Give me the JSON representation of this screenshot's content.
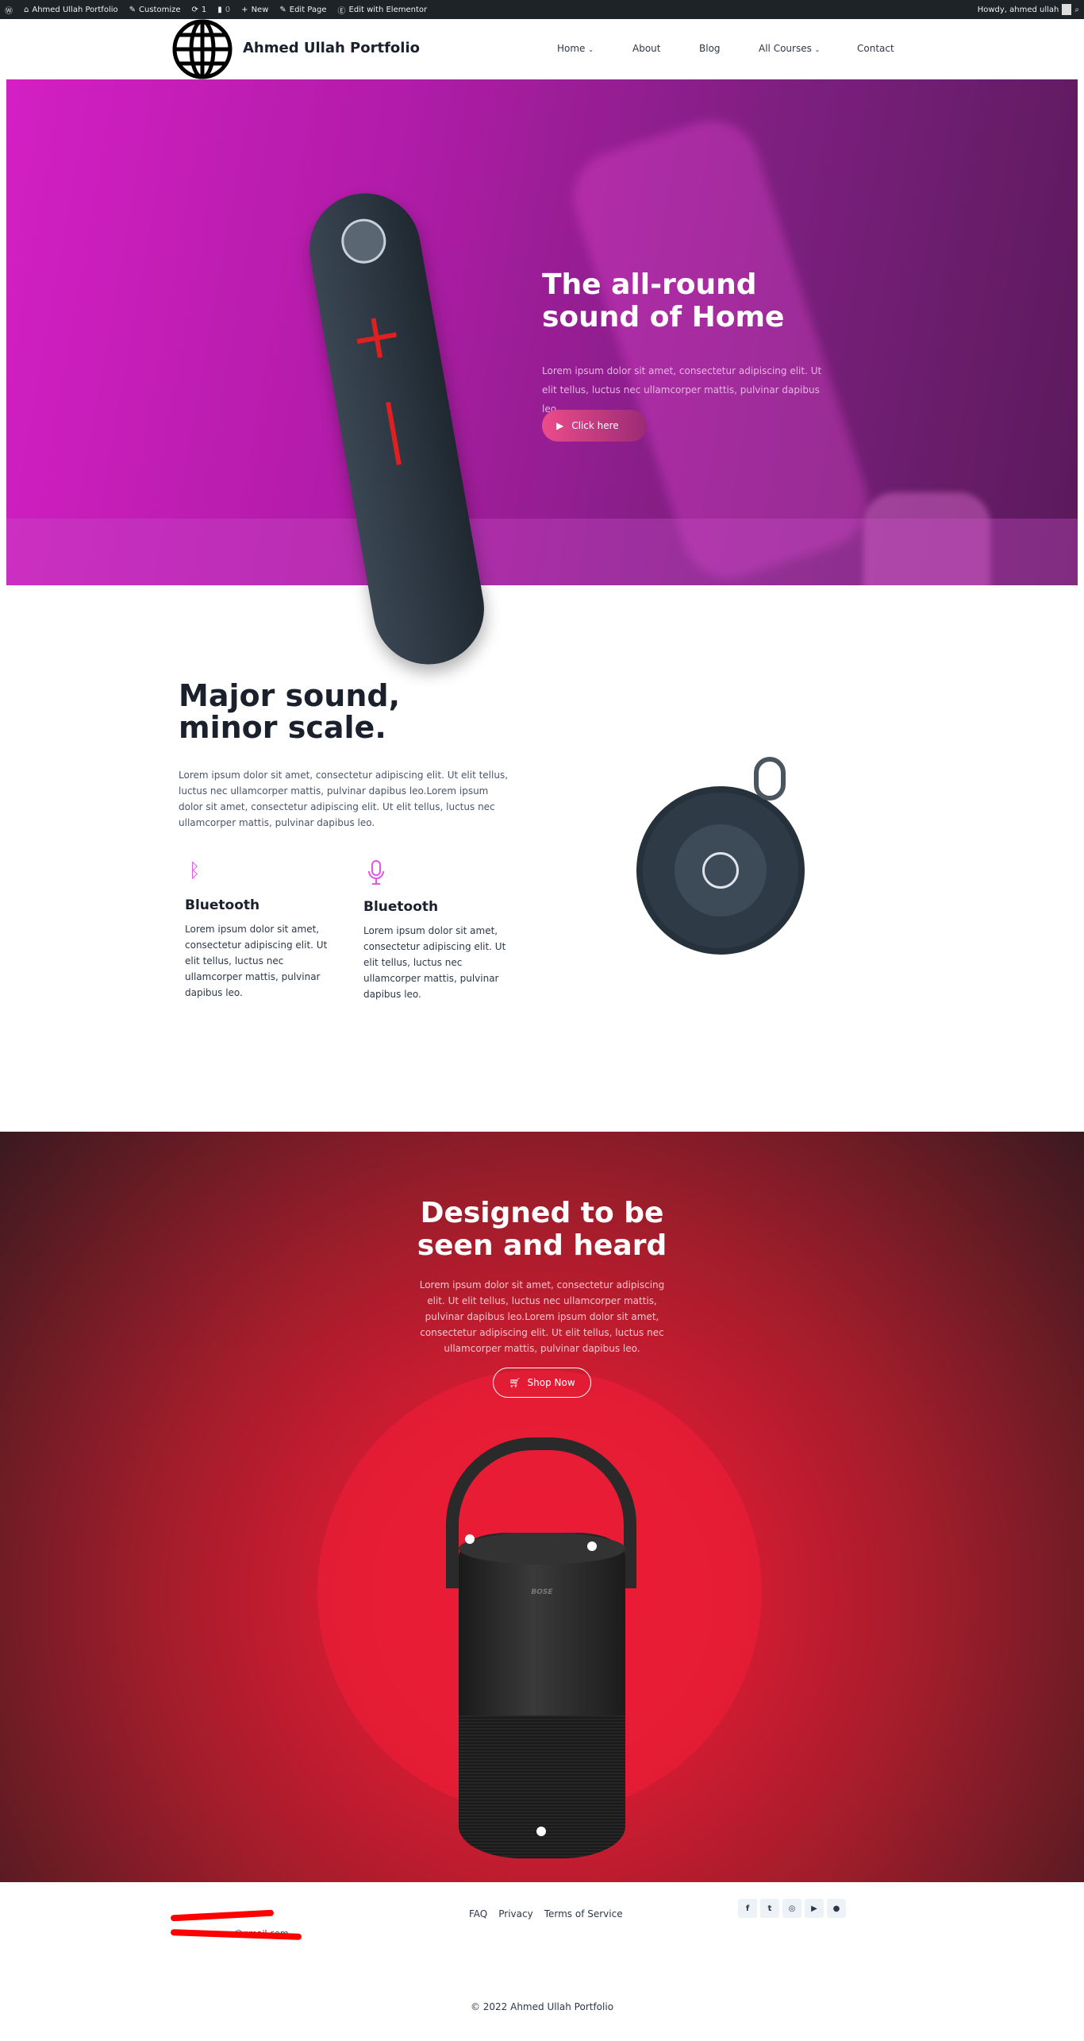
{
  "adminbar": {
    "site": "Ahmed Ullah Portfolio",
    "customize": "Customize",
    "updates": "1",
    "comments": "0",
    "new": "New",
    "edit_page": "Edit Page",
    "edit_elementor": "Edit with Elementor",
    "howdy": "Howdy, ahmed ullah"
  },
  "header": {
    "site_title": "Ahmed Ullah Portfolio",
    "nav": [
      "Home",
      "About",
      "Blog",
      "All Courses",
      "Contact"
    ]
  },
  "hero": {
    "title_line1": "The all-round",
    "title_line2": "sound of Home",
    "text": "Lorem ipsum dolor sit amet, consectetur adipiscing elit. Ut elit tellus, luctus nec ullamcorper mattis, pulvinar dapibus leo.",
    "button": "Click here"
  },
  "about": {
    "title_line1": "Major sound,",
    "title_line2": "minor scale.",
    "text": "Lorem ipsum dolor sit amet, consectetur adipiscing elit. Ut elit tellus, luctus nec ullamcorper mattis, pulvinar dapibus leo.Lorem ipsum dolor sit amet, consectetur adipiscing elit. Ut elit tellus, luctus nec ullamcorper mattis, pulvinar dapibus leo.",
    "features": [
      {
        "icon": "bluetooth-icon",
        "title": "Bluetooth",
        "text": "Lorem ipsum dolor sit amet, consectetur adipiscing elit. Ut elit tellus, luctus nec ullamcorper mattis, pulvinar dapibus leo."
      },
      {
        "icon": "microphone-icon",
        "title": "Bluetooth",
        "text": "Lorem ipsum dolor sit amet, consectetur adipiscing elit. Ut elit tellus, luctus nec ullamcorper mattis, pulvinar dapibus leo."
      }
    ],
    "accent": "#e056e8"
  },
  "promo": {
    "title_line1": "Designed to be",
    "title_line2": "seen and heard",
    "text": "Lorem ipsum dolor sit amet, consectetur adipiscing elit. Ut elit tellus, luctus nec ullamcorper mattis, pulvinar dapibus leo.Lorem ipsum dolor sit amet, consectetur adipiscing elit. Ut elit tellus, luctus nec ullamcorper mattis, pulvinar dapibus leo.",
    "button": "Shop Now",
    "brand": "BOSE"
  },
  "footer": {
    "email_partial": "@gmail.com",
    "links": [
      "FAQ",
      "Privacy",
      "Terms of Service"
    ],
    "social": [
      "facebook-icon",
      "twitter-icon",
      "instagram-icon",
      "youtube-icon",
      "github-icon"
    ],
    "copyright": "© 2022 Ahmed Ullah Portfolio"
  }
}
